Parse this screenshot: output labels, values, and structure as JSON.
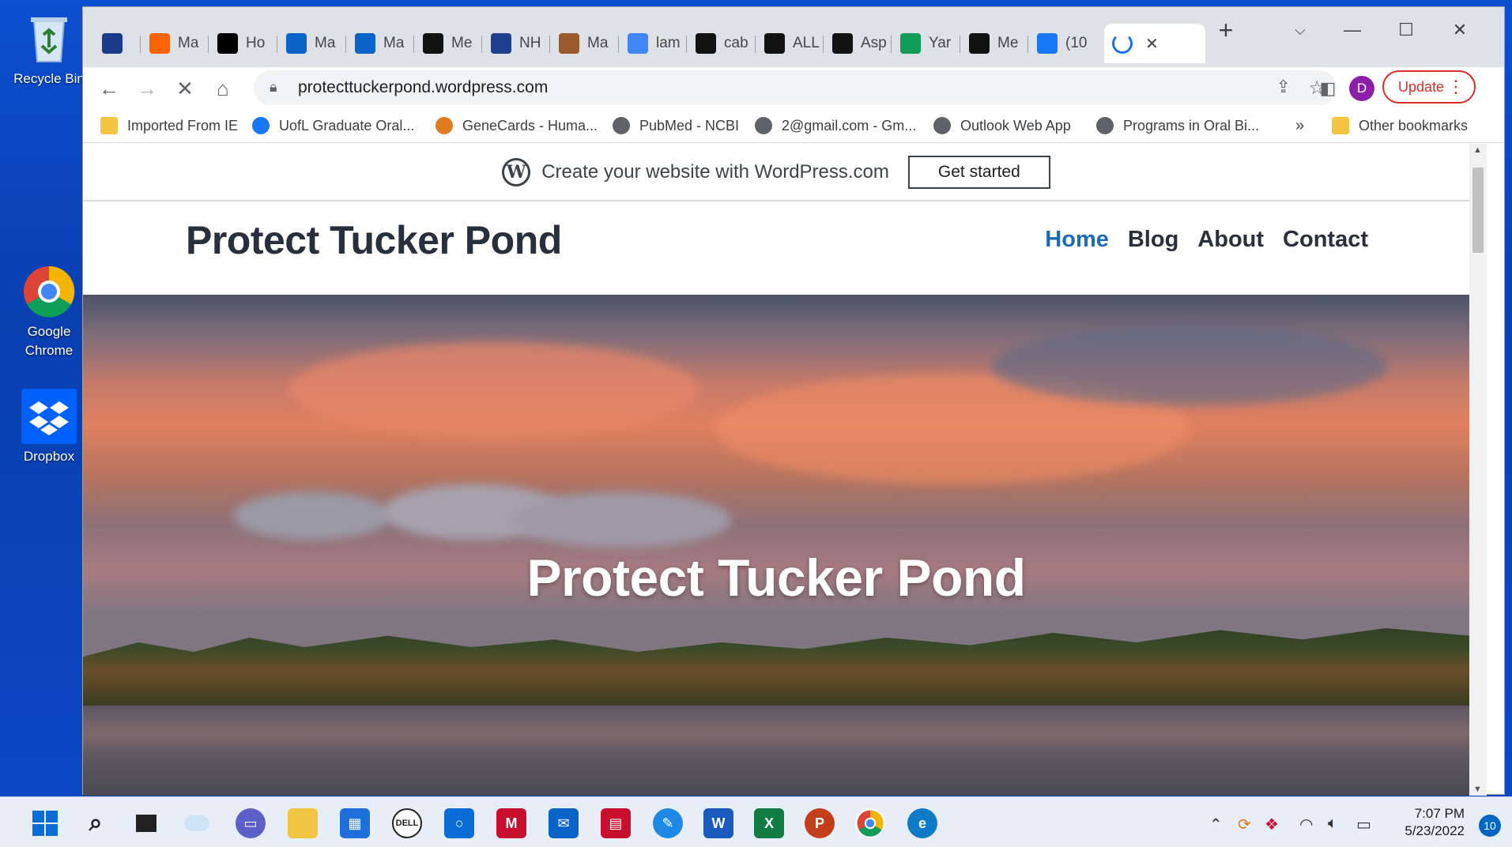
{
  "desktop": {
    "icons": [
      {
        "label": "Recycle Bin"
      },
      {
        "label": "Google Chrome"
      },
      {
        "label": "Dropbox"
      }
    ]
  },
  "browser": {
    "tabs": [
      {
        "label": "",
        "icon": "weather-channel-icon",
        "color": "#1b3a8a"
      },
      {
        "label": "Ma",
        "icon": "home-depot-icon",
        "color": "#f96302"
      },
      {
        "label": "Ho",
        "icon": "medium-icon",
        "color": "#000000"
      },
      {
        "label": "Ma",
        "icon": "outlook-icon",
        "color": "#0a64c8"
      },
      {
        "label": "Ma",
        "icon": "outlook-icon",
        "color": "#0a64c8"
      },
      {
        "label": "Me",
        "icon": "nytimes-icon",
        "color": "#111111"
      },
      {
        "label": "NH",
        "icon": "nh-icon",
        "color": "#1f3f8f"
      },
      {
        "label": "Ma",
        "icon": "map-icon",
        "color": "#9a5a2b"
      },
      {
        "label": "lam",
        "icon": "google-icon",
        "color": "#4285f4"
      },
      {
        "label": "cab",
        "icon": "amazon-icon",
        "color": "#111111"
      },
      {
        "label": "ALL",
        "icon": "amazon-icon",
        "color": "#111111"
      },
      {
        "label": "Asp",
        "icon": "amazon-icon",
        "color": "#111111"
      },
      {
        "label": "Yar",
        "icon": "plus-green-icon",
        "color": "#0f9d58"
      },
      {
        "label": "Me",
        "icon": "nytimes-icon",
        "color": "#111111"
      },
      {
        "label": "(10",
        "icon": "facebook-icon",
        "color": "#1877f2"
      }
    ],
    "active_tab_close": "✕",
    "new_tab": "+",
    "url": "protecttuckerpond.wordpress.com",
    "update_label": "Update",
    "profile_initial": "D",
    "bookmarks": [
      {
        "label": "Imported From IE",
        "color": "#f4c542"
      },
      {
        "label": "UofL Graduate Oral...",
        "color": "#1877f2"
      },
      {
        "label": "GeneCards - Huma...",
        "color": "#e07a1f"
      },
      {
        "label": "PubMed - NCBI",
        "color": "#5f6368"
      },
      {
        "label": "2@gmail.com - Gm...",
        "color": "#5f6368"
      },
      {
        "label": "Outlook Web App",
        "color": "#5f6368"
      },
      {
        "label": "Programs in Oral Bi...",
        "color": "#5f6368"
      }
    ],
    "bookmarks_overflow": "»",
    "other_bookmarks": "Other bookmarks"
  },
  "page": {
    "banner_text": "Create your website with WordPress.com",
    "banner_button": "Get started",
    "site_title": "Protect Tucker Pond",
    "nav": [
      "Home",
      "Blog",
      "About",
      "Contact"
    ],
    "hero_title": "Protect Tucker Pond"
  },
  "taskbar": {
    "time": "7:07 PM",
    "date": "5/23/2022",
    "notifications": "10"
  }
}
